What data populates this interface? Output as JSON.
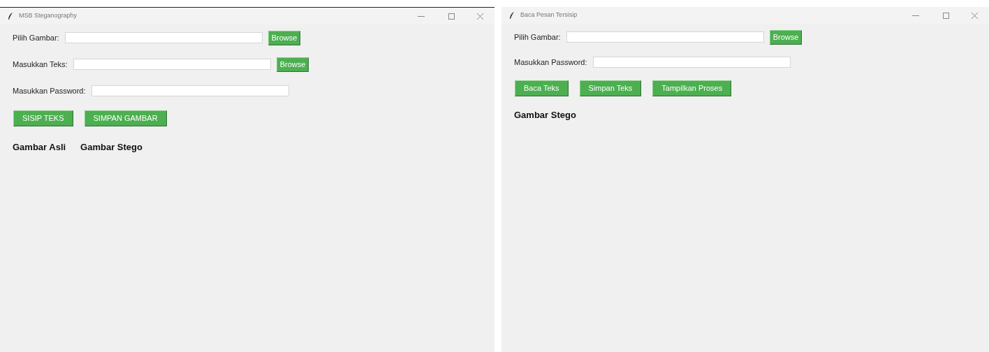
{
  "windows": [
    {
      "title": "MSB Steganography",
      "rows": [
        {
          "kind": "file",
          "label": "Pilih Gambar:",
          "button": "Browse"
        },
        {
          "kind": "file",
          "label": "Masukkan Teks:",
          "button": "Browse"
        },
        {
          "kind": "text",
          "label": "Masukkan Password:"
        }
      ],
      "buttons": [
        "SISIP TEKS",
        "SIMPAN GAMBAR"
      ],
      "image_labels": [
        "Gambar Asli",
        "Gambar Stego"
      ]
    },
    {
      "title": "Baca Pesan Tersisip",
      "rows": [
        {
          "kind": "file",
          "label": "Pilih Gambar:",
          "button": "Browse"
        },
        {
          "kind": "text",
          "label": "Masukkan Password:"
        }
      ],
      "buttons": [
        "Baca Teks",
        "Simpan Teks",
        "Tampilkan Proses"
      ],
      "image_labels": [
        "Gambar Stego"
      ]
    }
  ]
}
